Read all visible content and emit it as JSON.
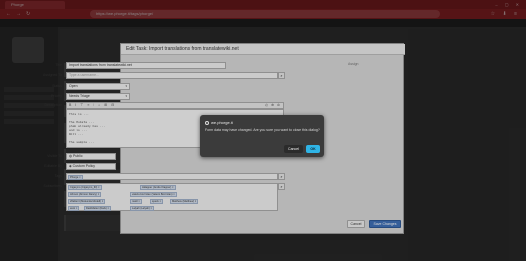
{
  "browser": {
    "tab_title": "Phorge",
    "url": "https://we.phorge.it/tags/phorge/",
    "window_controls": "– ▢ ✕",
    "back_icon": "arrow-left-icon",
    "forward_icon": "arrow-right-icon",
    "reload_icon": "reload-icon"
  },
  "modal": {
    "title": "Edit Task: Import translations from translatewiki.net",
    "side_link": "Assign",
    "fields": {
      "title": {
        "label": "Title",
        "value": "Import translations from translatewiki.net"
      },
      "assigned_to": {
        "label": "Assigned To",
        "placeholder": "Type a username..."
      },
      "status": {
        "label": "Status",
        "value": "Open"
      },
      "priority": {
        "label": "Priority",
        "value": "Needs Triage"
      },
      "description": {
        "label": "Description",
        "lines": [
          "This is ...",
          "",
          "The Hubsta ...",
          "phab already has ...",
          "and is ...",
          "Will ...",
          "",
          "The sample ..."
        ]
      },
      "visible_to": {
        "label": "Visible To",
        "value": "Public"
      },
      "editable_by": {
        "label": "Editable By",
        "value": "Custom Policy"
      },
      "tags": {
        "label": "Tags",
        "tokens": [
          "Phorge"
        ]
      },
      "subscribers": {
        "label": "Subscribers",
        "tokens": [
          "Cigaryno (Cigaryno_ID)",
          "Aklapper (Andre Klapper)",
          "Ahmon (Ahmon Dancy)",
          "valerio.bozzolan (Valerio Bozzolan)",
          "20after4 (Mukunda Modell)",
          "mattl",
          "speck",
          "Matthew (Matthew)",
          "avivi",
          "DarkMatter (Dark)",
          "Lalyah (Lalyah)"
        ]
      }
    },
    "toolbar": {
      "left": "B I ⊤ ≡ ⁝ ⌕ ⊞ ⊟",
      "right": "◴ ⊕ ⊘"
    },
    "cancel_label": "Cancel",
    "save_label": "Save Changes"
  },
  "dialog": {
    "title": "we.phorge.it",
    "message": "Form data may have changed. Are you sure you want to close this dialog?",
    "cancel_label": "Cancel",
    "ok_label": "OK"
  }
}
